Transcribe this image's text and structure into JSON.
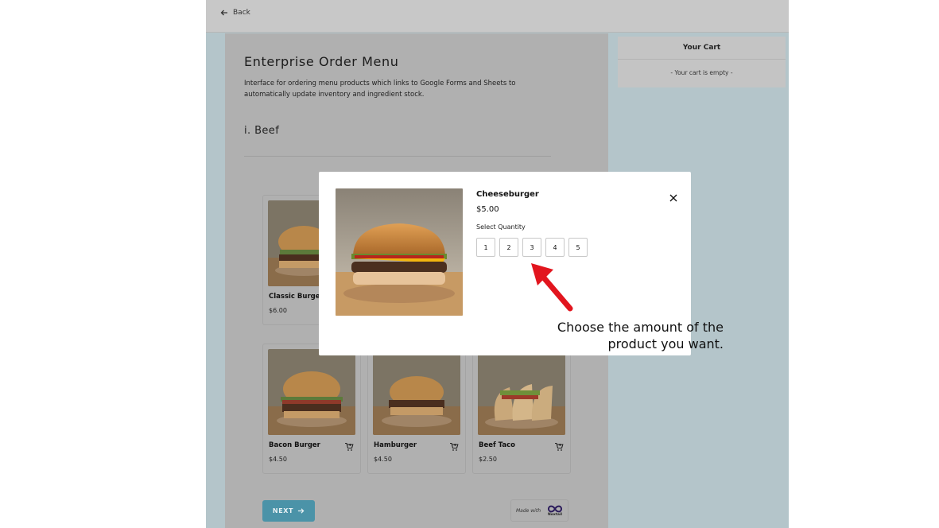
{
  "topbar": {
    "back_label": "Back"
  },
  "menu": {
    "title": "Enterprise Order Menu",
    "description": "Interface for ordering menu products which links to Google Forms and Sheets to automatically update inventory and ingredient stock.",
    "section_title": "i. Beef",
    "items": [
      {
        "name": "Classic Burge",
        "price": "$6.00"
      },
      {
        "name": "Bacon Burger",
        "price": "$4.50"
      },
      {
        "name": "Hamburger",
        "price": "$4.50"
      },
      {
        "name": "Beef Taco",
        "price": "$2.50"
      }
    ]
  },
  "cart": {
    "title": "Your Cart",
    "empty_text": "- Your cart is empty -"
  },
  "footer": {
    "next_label": "NEXT",
    "made_with": "Made with",
    "brand": "Noxtail"
  },
  "modal": {
    "product_name": "Cheeseburger",
    "price": "$5.00",
    "select_label": "Select Quantity",
    "quantities": [
      "1",
      "2",
      "3",
      "4",
      "5"
    ]
  },
  "annotation": {
    "line1": "Choose the amount of the",
    "line2": "product you want."
  },
  "colors": {
    "accent": "#4b93a8",
    "overlay": "#b4c5ca",
    "arrow": "#e2151e"
  }
}
